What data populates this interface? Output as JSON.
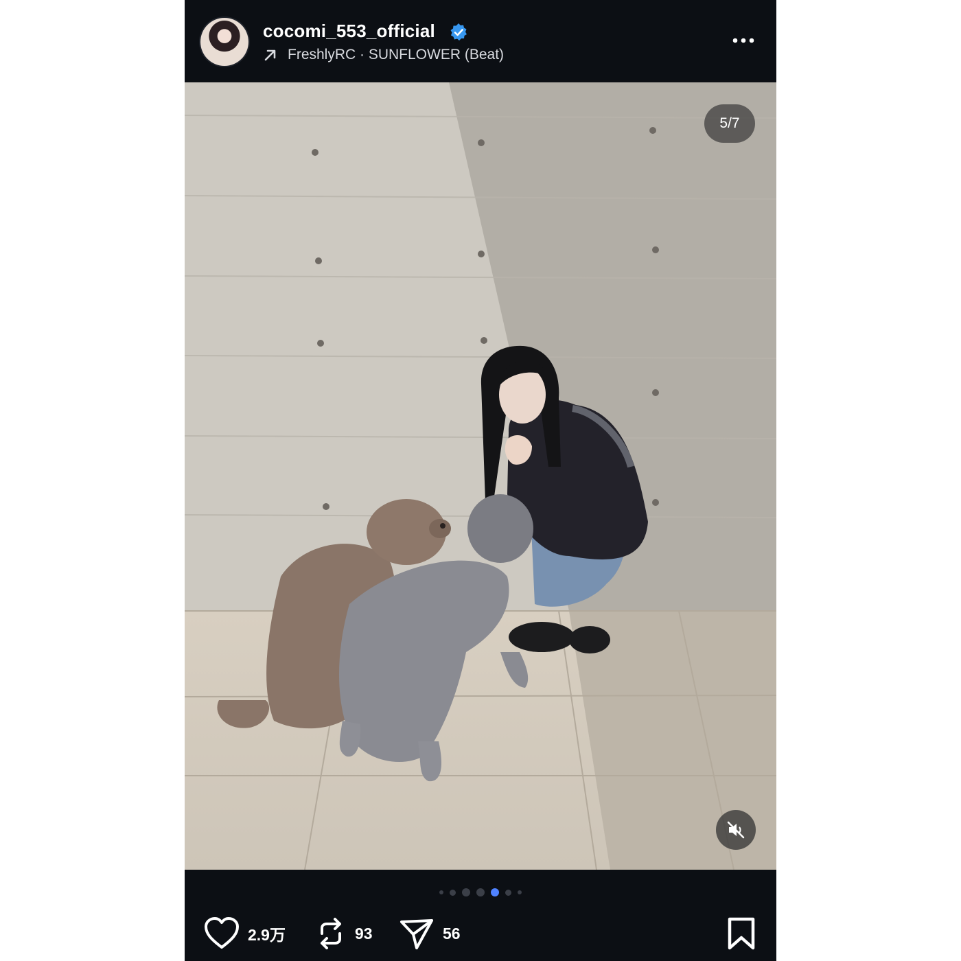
{
  "header": {
    "username": "cocomi_553_official",
    "verified": true,
    "audio": "FreshlyRC · SUNFLOWER (Beat)"
  },
  "media": {
    "counter": "5/7",
    "muted": true,
    "total_slides": 7,
    "current_slide": 5
  },
  "footer": {
    "likes": "2.9万",
    "reposts": "93",
    "shares": "56"
  },
  "colors": {
    "background": "#0c0f14",
    "verified": "#3797f0",
    "active_dot": "#4f82ff"
  },
  "icons": [
    "more-icon",
    "arrow-up-right-icon",
    "verified-icon",
    "mute-icon",
    "heart-icon",
    "repost-icon",
    "send-icon",
    "bookmark-icon"
  ]
}
